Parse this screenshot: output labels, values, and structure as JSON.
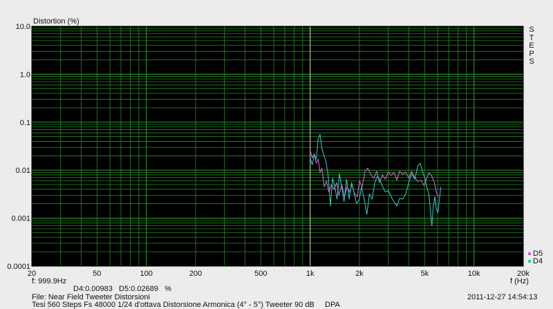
{
  "chart_data": {
    "type": "line",
    "title": "Distortion (%)",
    "xlabel": "f (Hz)",
    "ylabel": "Distortion (%)",
    "xscale": "log",
    "yscale": "log",
    "xlim": [
      20,
      20000
    ],
    "ylim": [
      0.0001,
      10
    ],
    "x_ticks": [
      20,
      50,
      100,
      200,
      500,
      1000,
      2000,
      5000,
      10000,
      20000
    ],
    "x_tick_labels": [
      "20",
      "50",
      "100",
      "200",
      "500",
      "1k",
      "2k",
      "5k",
      "10k",
      "20k"
    ],
    "y_ticks": [
      10,
      1,
      0.1,
      0.01,
      0.001,
      0.0001
    ],
    "y_tick_labels": [
      "10.0",
      "1.0",
      "0.1",
      "0.01",
      "0.001",
      "0.0001"
    ],
    "grid": true,
    "cursor_x": 999.9,
    "legend_position": "bottom-right",
    "series": [
      {
        "name": "D5",
        "color": "#cc66cc",
        "points": [
          [
            1000,
            0.026
          ],
          [
            1030,
            0.018
          ],
          [
            1060,
            0.022
          ],
          [
            1090,
            0.014
          ],
          [
            1120,
            0.017
          ],
          [
            1150,
            0.009
          ],
          [
            1180,
            0.011
          ],
          [
            1220,
            0.0045
          ],
          [
            1260,
            0.006
          ],
          [
            1300,
            0.0035
          ],
          [
            1350,
            0.005
          ],
          [
            1400,
            0.004
          ],
          [
            1450,
            0.0055
          ],
          [
            1500,
            0.003
          ],
          [
            1560,
            0.005
          ],
          [
            1620,
            0.0028
          ],
          [
            1680,
            0.0045
          ],
          [
            1740,
            0.0035
          ],
          [
            1800,
            0.005
          ],
          [
            1870,
            0.0032
          ],
          [
            1940,
            0.0028
          ],
          [
            2000,
            0.006
          ],
          [
            2080,
            0.0045
          ],
          [
            2160,
            0.0095
          ],
          [
            2250,
            0.011
          ],
          [
            2350,
            0.008
          ],
          [
            2450,
            0.0068
          ],
          [
            2550,
            0.0095
          ],
          [
            2650,
            0.0055
          ],
          [
            2760,
            0.008
          ],
          [
            2880,
            0.0065
          ],
          [
            3000,
            0.0092
          ],
          [
            3120,
            0.0078
          ],
          [
            3250,
            0.009
          ],
          [
            3380,
            0.0062
          ],
          [
            3520,
            0.0095
          ],
          [
            3670,
            0.0082
          ],
          [
            3830,
            0.0092
          ],
          [
            4000,
            0.0068
          ],
          [
            4170,
            0.0095
          ],
          [
            4350,
            0.007
          ],
          [
            4550,
            0.0058
          ],
          [
            4750,
            0.0062
          ],
          [
            4950,
            0.0048
          ],
          [
            5150,
            0.0068
          ],
          [
            5300,
            0.0088
          ],
          [
            5500,
            0.0078
          ],
          [
            5700,
            0.0058
          ],
          [
            5900,
            0.0035
          ],
          [
            6050,
            0.0028
          ]
        ]
      },
      {
        "name": "D4",
        "color": "#2fc4b8",
        "points": [
          [
            1000,
            0.018
          ],
          [
            1030,
            0.013
          ],
          [
            1060,
            0.021
          ],
          [
            1090,
            0.017
          ],
          [
            1120,
            0.045
          ],
          [
            1150,
            0.056
          ],
          [
            1180,
            0.028
          ],
          [
            1210,
            0.021
          ],
          [
            1250,
            0.015
          ],
          [
            1290,
            0.0075
          ],
          [
            1330,
            0.0018
          ],
          [
            1370,
            0.0068
          ],
          [
            1410,
            0.0048
          ],
          [
            1460,
            0.0025
          ],
          [
            1510,
            0.0085
          ],
          [
            1560,
            0.0045
          ],
          [
            1610,
            0.0022
          ],
          [
            1670,
            0.0065
          ],
          [
            1730,
            0.0025
          ],
          [
            1790,
            0.0055
          ],
          [
            1850,
            0.0035
          ],
          [
            1920,
            0.002
          ],
          [
            1990,
            0.0024
          ],
          [
            2060,
            0.0045
          ],
          [
            2140,
            0.0025
          ],
          [
            2220,
            0.0012
          ],
          [
            2300,
            0.0032
          ],
          [
            2390,
            0.0025
          ],
          [
            2480,
            0.0055
          ],
          [
            2570,
            0.0075
          ],
          [
            2670,
            0.0062
          ],
          [
            2770,
            0.0045
          ],
          [
            2880,
            0.0035
          ],
          [
            3000,
            0.0038
          ],
          [
            3120,
            0.0028
          ],
          [
            3250,
            0.0022
          ],
          [
            3380,
            0.0018
          ],
          [
            3520,
            0.0026
          ],
          [
            3670,
            0.0025
          ],
          [
            3830,
            0.0032
          ],
          [
            4000,
            0.0055
          ],
          [
            4170,
            0.0085
          ],
          [
            4350,
            0.0065
          ],
          [
            4550,
            0.0125
          ],
          [
            4700,
            0.014
          ],
          [
            4850,
            0.0095
          ],
          [
            5000,
            0.007
          ],
          [
            5150,
            0.0045
          ],
          [
            5300,
            0.0032
          ],
          [
            5420,
            0.0015
          ],
          [
            5530,
            0.0007
          ],
          [
            5650,
            0.0018
          ],
          [
            5780,
            0.0028
          ],
          [
            5900,
            0.0015
          ],
          [
            6030,
            0.0013
          ],
          [
            6150,
            0.0025
          ],
          [
            6280,
            0.0045
          ]
        ]
      }
    ]
  },
  "header": {
    "y_axis_title": "Distortion (%)"
  },
  "side_label": [
    "S",
    "T",
    "E",
    "P",
    "S"
  ],
  "legend": {
    "d5": "D5",
    "d4": "D4"
  },
  "footer": {
    "cursor_freq": "f: 999.9Hz",
    "cursor_values": "D4:0.00983   D5:0.02689   %",
    "file": "File: Near Field Tweeter Distorsioni",
    "description": "Tesi 560 Steps Fs 48000 1/24 d'ottava Distorsione Armonica (4° - 5°) Tweeter 90 dB     DPA",
    "timestamp": "2011-12-27 14:54:13",
    "x_unit": "f (Hz)"
  },
  "colors": {
    "plot_background": "#000000",
    "grid": "#2a8a2a",
    "cursor": "#c8c8a0",
    "d5": "#cc66cc",
    "d4": "#2fc4b8"
  }
}
